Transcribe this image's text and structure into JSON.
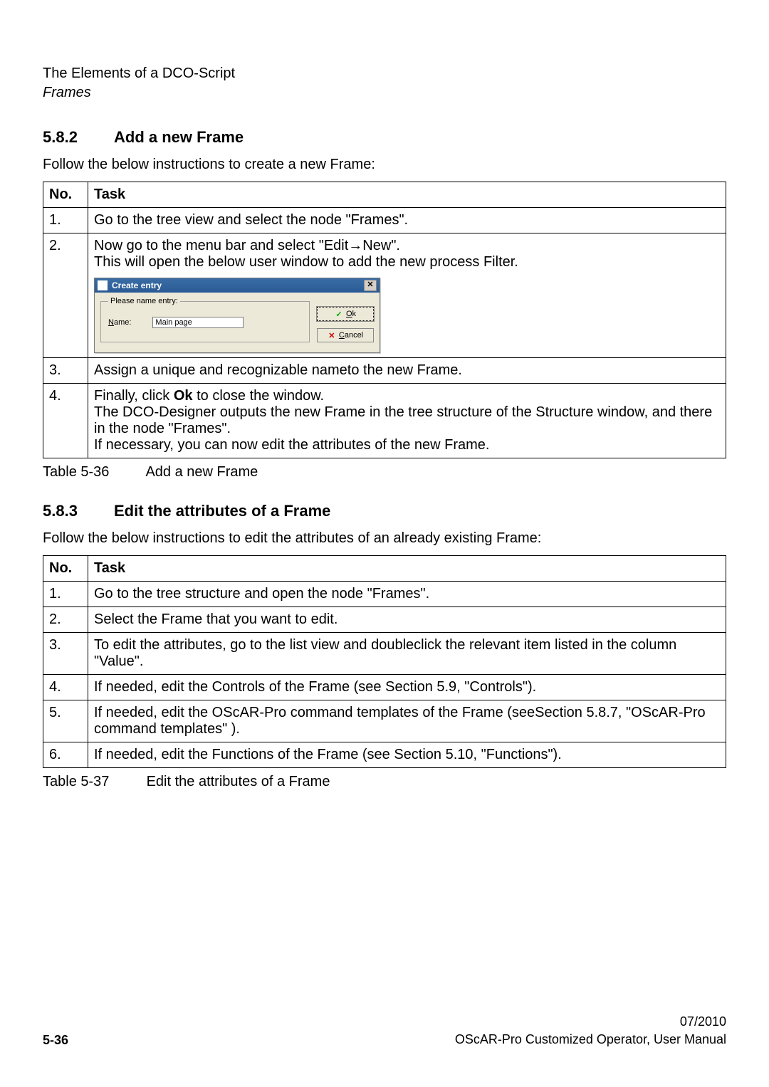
{
  "header": {
    "title": "The Elements of a DCO-Script",
    "subtitle": "Frames"
  },
  "section1": {
    "number": "5.8.2",
    "title": "Add a new Frame",
    "intro": "Follow the below instructions to create a new Frame:",
    "table": {
      "head_no": "No.",
      "head_task": "Task",
      "rows": {
        "r1_no": "1.",
        "r1_task": "Go to the tree view and select the node \"Frames\".",
        "r2_no": "2.",
        "r2_task_a": "Now go to the menu bar and select \"Edit→New\".",
        "r2_task_b": "This will open the below user window to add the new process Filter.",
        "r3_no": "3.",
        "r3_task": "Assign a unique and recognizable nameto the new Frame.",
        "r4_no": "4.",
        "r4_task_a_pre": "Finally, click ",
        "r4_task_a_bold": "Ok",
        "r4_task_a_post": " to close the window.",
        "r4_task_b": "The DCO-Designer outputs the new Frame in the tree structure of the Structure window, and there in the node \"Frames\".",
        "r4_task_c": "If necessary, you can now edit the attributes of the new Frame."
      }
    },
    "caption_label": "Table 5-36",
    "caption_text": "Add a new Frame"
  },
  "dialog": {
    "title": "Create entry",
    "legend": "Please name entry:",
    "name_label": "Name:",
    "name_label_ul": "N",
    "name_label_rest": "ame:",
    "name_value": "Main page",
    "ok_ul": "O",
    "ok_rest": "k",
    "cancel_ul": "C",
    "cancel_rest": "ancel",
    "close_glyph": "✕",
    "check_glyph": "✓",
    "x_glyph": "✕"
  },
  "section2": {
    "number": "5.8.3",
    "title": "Edit the attributes of a Frame",
    "intro": "Follow the below instructions to edit the attributes of an already existing Frame:",
    "table": {
      "head_no": "No.",
      "head_task": "Task",
      "rows": {
        "r1_no": "1.",
        "r1_task": "Go to the tree structure and open the node \"Frames\".",
        "r2_no": "2.",
        "r2_task": "Select the Frame that you want to edit.",
        "r3_no": "3.",
        "r3_task": "To edit the attributes, go to the list view and doubleclick the relevant item listed in the column \"Value\".",
        "r4_no": "4.",
        "r4_task": "If needed, edit the Controls of the Frame (see Section 5.9, \"Controls\").",
        "r5_no": "5.",
        "r5_task": "If needed, edit the OScAR-Pro command templates of the Frame (seeSection 5.8.7, \"OScAR-Pro command templates\" ).",
        "r6_no": "6.",
        "r6_task": "If needed, edit the Functions of the Frame (see Section 5.10, \"Functions\")."
      }
    },
    "caption_label": "Table 5-37",
    "caption_text": "Edit the attributes of a Frame"
  },
  "footer": {
    "page": "5-36",
    "date": "07/2010",
    "doc": "OScAR-Pro Customized Operator, User Manual"
  }
}
